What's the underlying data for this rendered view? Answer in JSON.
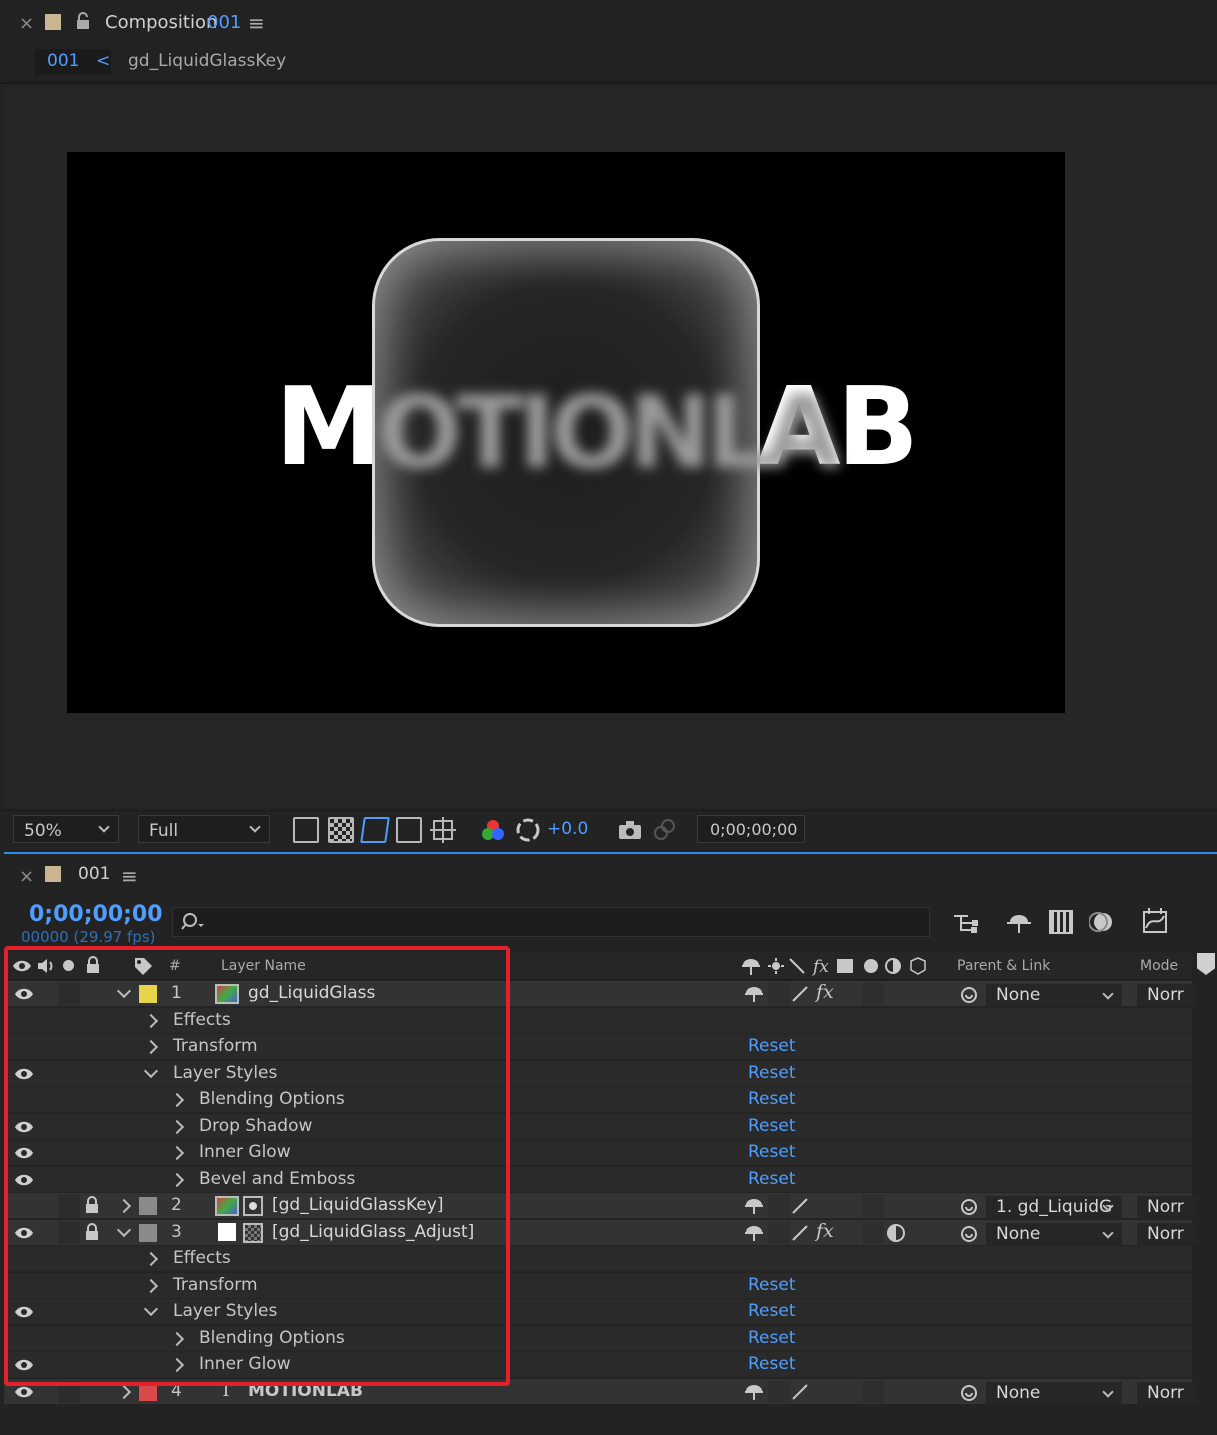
{
  "comp_panel": {
    "close": "×",
    "title": "Composition",
    "comp_number": "001",
    "menu": "≡",
    "breadcrumb_comp": "001",
    "breadcrumb_arrow": "<",
    "breadcrumb_layer": "gd_LiquidGlassKey"
  },
  "viewer": {
    "text_left": "M",
    "text_center": "OTIONLA",
    "text_right": "AB"
  },
  "toolbar": {
    "zoom": "50%",
    "resolution": "Full",
    "exposure": "+0.0",
    "timecode": "0;00;00;00"
  },
  "timeline": {
    "close": "×",
    "tab_name": "001",
    "menu": "≡",
    "current_time": "0;00;00;00",
    "frame_info": "00000 (29.97 fps)",
    "columns": {
      "number": "#",
      "layer_name": "Layer Name",
      "parent_link": "Parent & Link",
      "mode": "Mode"
    },
    "rows": [
      {
        "type": "layer",
        "num": "1",
        "name": "gd_LiquidGlass",
        "color": "#e8d44a",
        "parent": "None",
        "mode": "Norr",
        "eye": true,
        "lock": false,
        "expanded": true,
        "fx": true
      },
      {
        "type": "group",
        "indent": 1,
        "name": "Effects",
        "reset": "",
        "eye": false,
        "expanded": false
      },
      {
        "type": "group",
        "indent": 1,
        "name": "Transform",
        "reset": "Reset",
        "eye": false,
        "expanded": false
      },
      {
        "type": "group",
        "indent": 1,
        "name": "Layer Styles",
        "reset": "Reset",
        "eye": true,
        "expanded": true
      },
      {
        "type": "group",
        "indent": 2,
        "name": "Blending Options",
        "reset": "Reset",
        "eye": false,
        "expanded": false
      },
      {
        "type": "group",
        "indent": 2,
        "name": "Drop Shadow",
        "reset": "Reset",
        "eye": true,
        "expanded": false
      },
      {
        "type": "group",
        "indent": 2,
        "name": "Inner Glow",
        "reset": "Reset",
        "eye": true,
        "expanded": false
      },
      {
        "type": "group",
        "indent": 2,
        "name": "Bevel and Emboss",
        "reset": "Reset",
        "eye": true,
        "expanded": false
      },
      {
        "type": "layer",
        "num": "2",
        "name": "[gd_LiquidGlassKey]",
        "color": "#8a8a8a",
        "parent": "1. gd_LiquidG",
        "mode": "Norr",
        "eye": false,
        "lock": true,
        "expanded": false,
        "fx": false
      },
      {
        "type": "layer",
        "num": "3",
        "name": "[gd_LiquidGlass_Adjust]",
        "color": "#8a8a8a",
        "parent": "None",
        "mode": "Norr",
        "eye": true,
        "lock": true,
        "expanded": true,
        "fx": true
      },
      {
        "type": "group",
        "indent": 1,
        "name": "Effects",
        "reset": "",
        "eye": false,
        "expanded": false
      },
      {
        "type": "group",
        "indent": 1,
        "name": "Transform",
        "reset": "Reset",
        "eye": false,
        "expanded": false
      },
      {
        "type": "group",
        "indent": 1,
        "name": "Layer Styles",
        "reset": "Reset",
        "eye": true,
        "expanded": true
      },
      {
        "type": "group",
        "indent": 2,
        "name": "Blending Options",
        "reset": "Reset",
        "eye": false,
        "expanded": false
      },
      {
        "type": "group",
        "indent": 2,
        "name": "Inner Glow",
        "reset": "Reset",
        "eye": true,
        "expanded": false
      },
      {
        "type": "layer",
        "num": "4",
        "name": "MOTIONLAB",
        "color": "#d94a4a",
        "parent": "None",
        "mode": "Norr",
        "eye": true,
        "lock": false,
        "expanded": false,
        "fx": false
      }
    ]
  },
  "colors": {
    "accent": "#2d8ceb",
    "reset_link": "#4f9eff",
    "highlight_box": "#e4212b"
  }
}
